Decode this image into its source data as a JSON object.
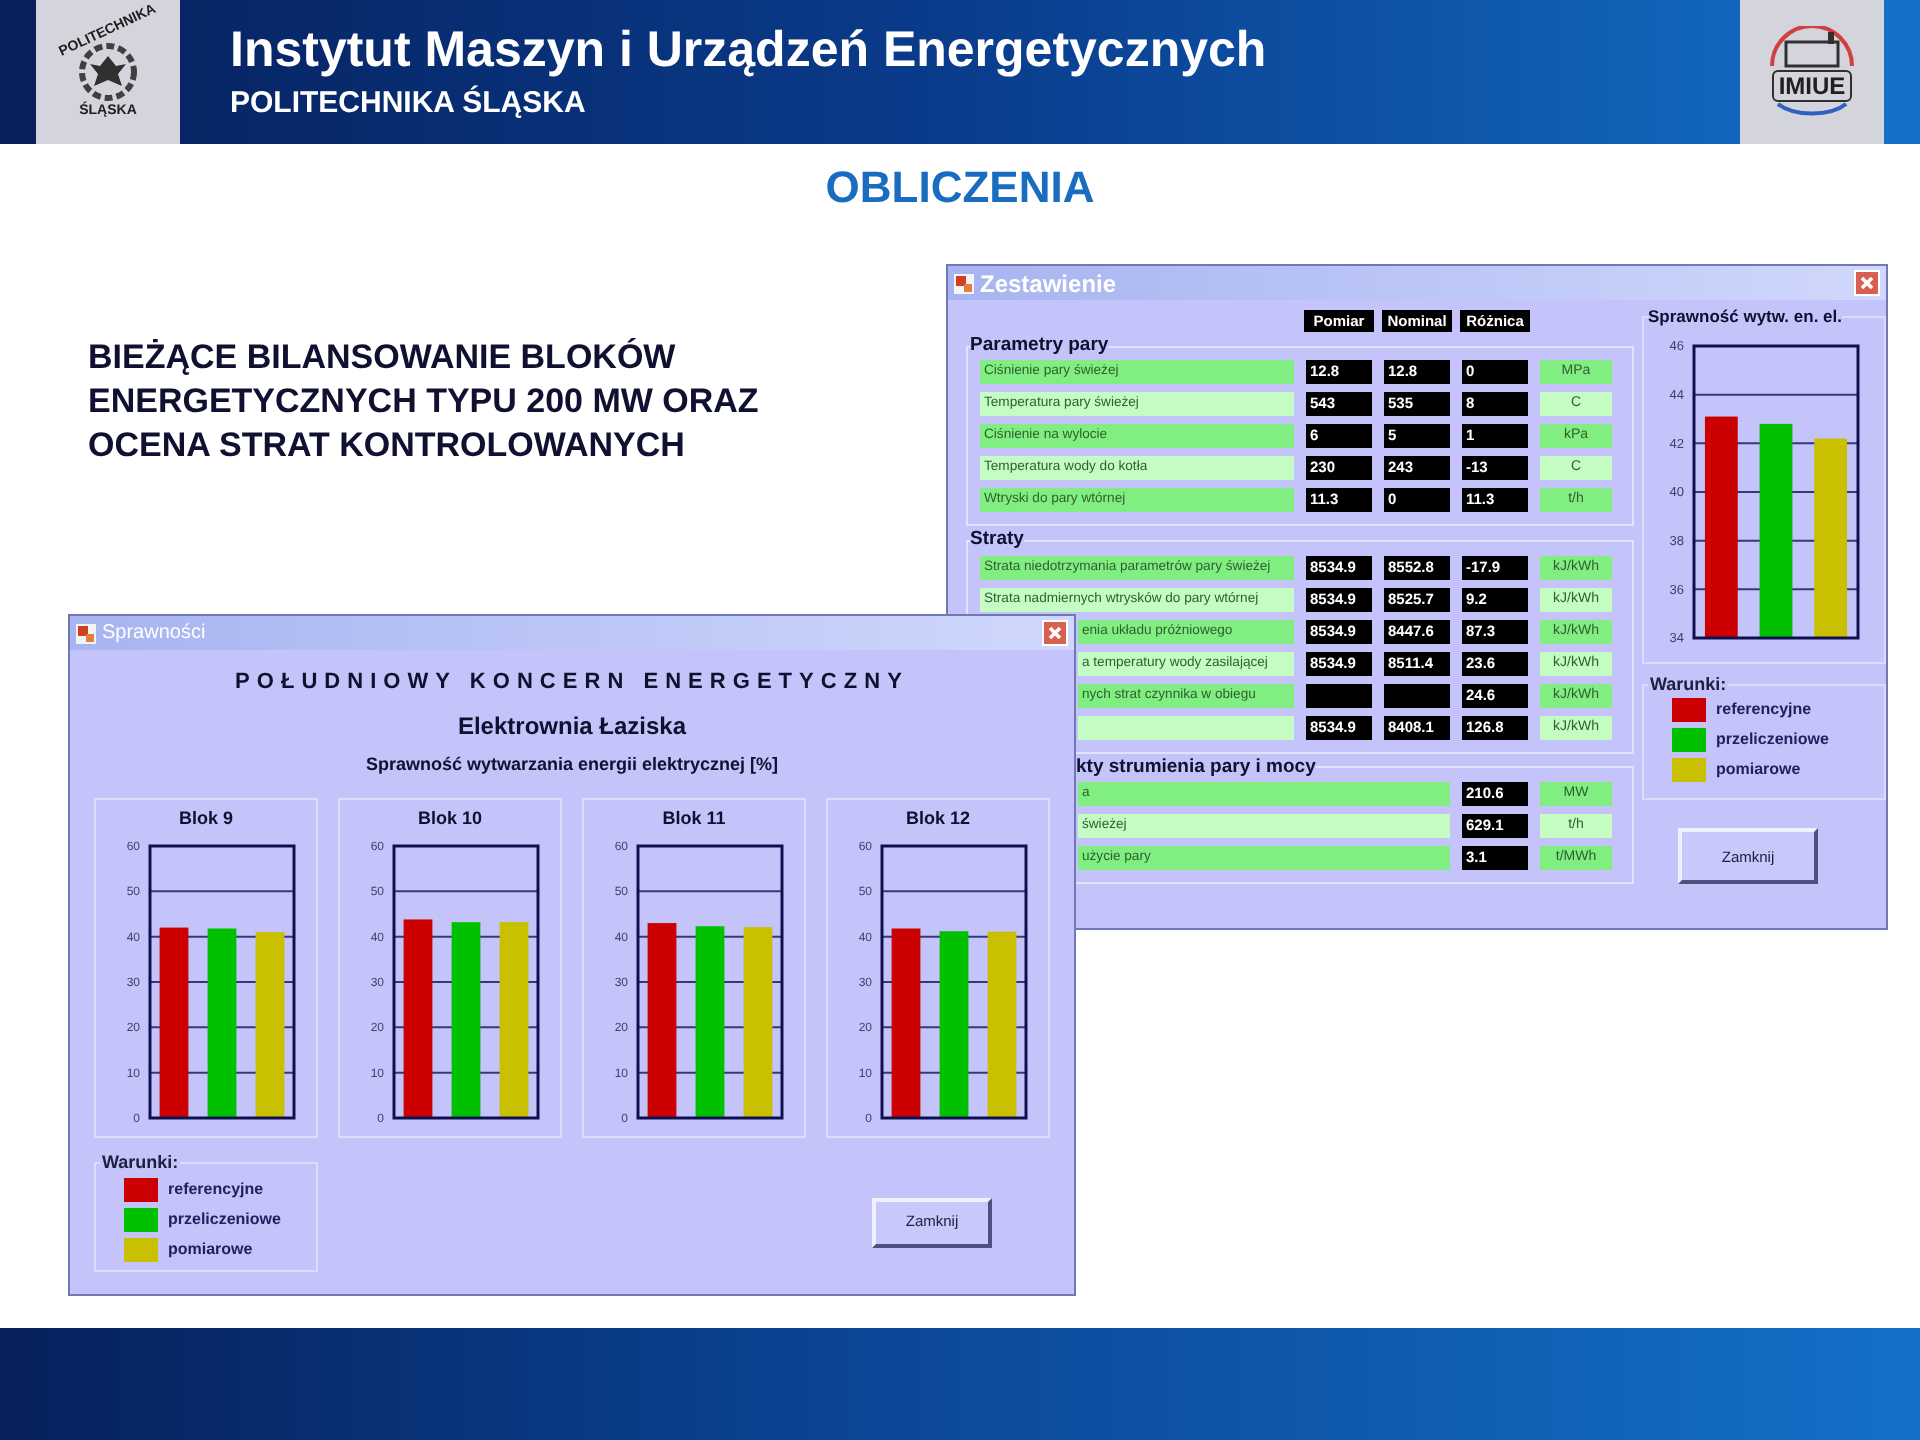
{
  "header": {
    "title": "Instytut Maszyn i Urządzeń Energetycznych",
    "subtitle": "POLITECHNIKA ŚLĄSKA",
    "logo_left": {
      "top": "POLITECHNIKA",
      "bottom": "ŚLĄSKA"
    },
    "logo_right": "IMIUE"
  },
  "page_title": "OBLICZENIA",
  "heading": "BIEŻĄCE BILANSOWANIE BLOKÓW ENERGETYCZNYCH TYPU 200 MW ORAZ OCENA STRAT KONTROLOWANYCH",
  "zestawienie": {
    "title": "Zestawienie",
    "columns": [
      "Pomiar",
      "Nominal",
      "Różnica"
    ],
    "sections": [
      {
        "title": "Parametry pary",
        "kind": "comparison",
        "rows": [
          {
            "label": "Ciśnienie pary świeżej",
            "pomiar": "12.8",
            "nominal": "12.8",
            "roznica": "0",
            "unit": "MPa"
          },
          {
            "label": "Temperatura pary świeżej",
            "pomiar": "543",
            "nominal": "535",
            "roznica": "8",
            "unit": "C"
          },
          {
            "label": "Ciśnienie na wylocie",
            "pomiar": "6",
            "nominal": "5",
            "roznica": "1",
            "unit": "kPa"
          },
          {
            "label": "Temperatura wody do kotła",
            "pomiar": "230",
            "nominal": "243",
            "roznica": "-13",
            "unit": "C"
          },
          {
            "label": "Wtryski do pary wtórnej",
            "pomiar": "11.3",
            "nominal": "0",
            "roznica": "11.3",
            "unit": "t/h"
          }
        ]
      },
      {
        "title": "Straty",
        "kind": "comparison",
        "rows": [
          {
            "label": "Strata niedotrzymania parametrów pary świeżej",
            "pomiar": "8534.9",
            "nominal": "8552.8",
            "roznica": "-17.9",
            "unit": "kJ/kWh"
          },
          {
            "label": "Strata nadmiernych wtrysków do pary wtórnej",
            "pomiar": "8534.9",
            "nominal": "8525.7",
            "roznica": "9.2",
            "unit": "kJ/kWh"
          },
          {
            "label": "enia układu próżniowego",
            "pomiar": "8534.9",
            "nominal": "8447.6",
            "roznica": "87.3",
            "unit": "kJ/kWh"
          },
          {
            "label": "a temperatury wody zasilającej",
            "pomiar": "8534.9",
            "nominal": "8511.4",
            "roznica": "23.6",
            "unit": "kJ/kWh"
          },
          {
            "label": "nych strat czynnika w obiegu",
            "roznica": "24.6",
            "unit": "kJ/kWh"
          },
          {
            "pomiar": "8534.9",
            "nominal": "8408.1",
            "roznica": "126.8",
            "unit": "kJ/kWh"
          }
        ]
      },
      {
        "title": "kty strumienia pary i mocy",
        "kind": "value",
        "rows": [
          {
            "label": "a",
            "value": "210.6",
            "unit": "MW"
          },
          {
            "label": "świeżej",
            "value": "629.1",
            "unit": "t/h"
          },
          {
            "label": "użycie pary",
            "value": "3.1",
            "unit": "t/MWh"
          }
        ]
      }
    ],
    "chart_data": {
      "type": "bar",
      "grid": true,
      "title": "Sprawność wytw. en. el.",
      "ylim": [
        34,
        46
      ],
      "yticks": [
        34,
        36,
        38,
        40,
        42,
        44,
        46
      ],
      "series": [
        {
          "color": "#cc0000",
          "values": [
            43.1
          ]
        },
        {
          "color": "#00c000",
          "values": [
            42.8
          ]
        },
        {
          "color": "#c8c000",
          "values": [
            42.2
          ]
        }
      ]
    },
    "legend": {
      "title": "Warunki:",
      "items": [
        {
          "label": "referencyjne",
          "color": "#cc0000"
        },
        {
          "label": "przeliczeniowe",
          "color": "#00c000"
        },
        {
          "label": "pomiarowe",
          "color": "#c8c000"
        }
      ]
    },
    "close_button": "Zamknij"
  },
  "sprawnosci": {
    "title": "Sprawności",
    "company": "POŁUDNIOWY KONCERN ENERGETYCZNY",
    "plant": "Elektrownia Łaziska",
    "subtitle": "Sprawność wytwarzania energii elektrycznej [%]",
    "blocks": [
      {
        "chart_data": {
          "type": "bar",
          "title": "Blok 9",
          "grid": true,
          "ylim": [
            0,
            60
          ],
          "yticks": [
            0,
            10,
            20,
            30,
            40,
            50,
            60
          ],
          "series": [
            {
              "color": "#cc0000",
              "values": [
                42
              ]
            },
            {
              "color": "#00c000",
              "values": [
                41.8
              ]
            },
            {
              "color": "#c8c000",
              "values": [
                41
              ]
            }
          ]
        }
      },
      {
        "chart_data": {
          "type": "bar",
          "title": "Blok 10",
          "grid": true,
          "ylim": [
            0,
            60
          ],
          "yticks": [
            0,
            10,
            20,
            30,
            40,
            50,
            60
          ],
          "series": [
            {
              "color": "#cc0000",
              "values": [
                43.8
              ]
            },
            {
              "color": "#00c000",
              "values": [
                43.2
              ]
            },
            {
              "color": "#c8c000",
              "values": [
                43.2
              ]
            }
          ]
        }
      },
      {
        "chart_data": {
          "type": "bar",
          "title": "Blok 11",
          "grid": true,
          "ylim": [
            0,
            60
          ],
          "yticks": [
            0,
            10,
            20,
            30,
            40,
            50,
            60
          ],
          "series": [
            {
              "color": "#cc0000",
              "values": [
                43
              ]
            },
            {
              "color": "#00c000",
              "values": [
                42.3
              ]
            },
            {
              "color": "#c8c000",
              "values": [
                42.1
              ]
            }
          ]
        }
      },
      {
        "chart_data": {
          "type": "bar",
          "title": "Blok 12",
          "grid": true,
          "ylim": [
            0,
            60
          ],
          "yticks": [
            0,
            10,
            20,
            30,
            40,
            50,
            60
          ],
          "series": [
            {
              "color": "#cc0000",
              "values": [
                41.8
              ]
            },
            {
              "color": "#00c000",
              "values": [
                41.2
              ]
            },
            {
              "color": "#c8c000",
              "values": [
                41.1
              ]
            }
          ]
        }
      }
    ],
    "legend": {
      "title": "Warunki:",
      "items": [
        {
          "label": "referencyjne",
          "color": "#cc0000"
        },
        {
          "label": "przeliczeniowe",
          "color": "#00c000"
        },
        {
          "label": "pomiarowe",
          "color": "#c8c000"
        }
      ]
    },
    "close_button": "Zamknij"
  }
}
